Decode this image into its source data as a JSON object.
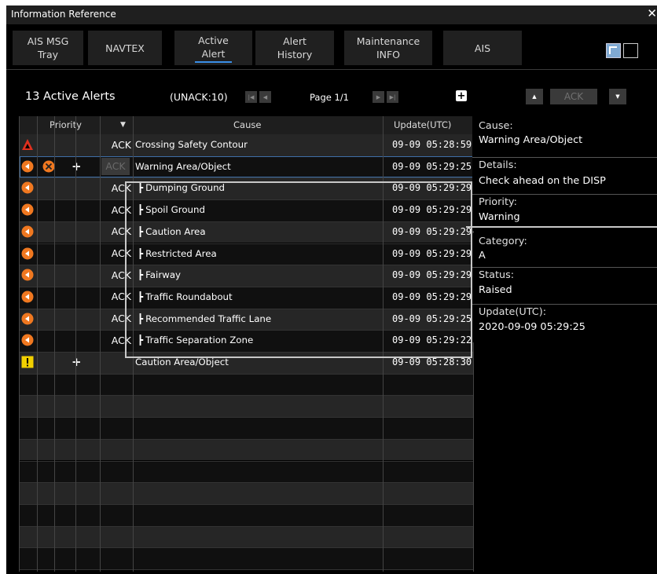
{
  "window": {
    "title": "Information Reference"
  },
  "tabs": [
    {
      "label": "AIS MSG\nTray",
      "active": false
    },
    {
      "label": "NAVTEX",
      "active": false
    },
    {
      "label": "Active\nAlert",
      "active": true
    },
    {
      "label": "Alert\nHistory",
      "active": false
    },
    {
      "label": "Maintenance\nINFO",
      "active": false
    },
    {
      "label": "AIS",
      "active": false
    }
  ],
  "toolbar": {
    "count_label": "13 Active Alerts",
    "unack_label": "(UNACK:10)",
    "page_label": "Page 1/1",
    "ack_label": "ACK"
  },
  "table": {
    "headers": {
      "priority": "Priority",
      "cause": "Cause",
      "update": "Update(UTC)"
    },
    "rows": [
      {
        "icon": "alarm-triangle-icon",
        "icon2": "",
        "plus": "",
        "ack": "ACK",
        "ack_dim": false,
        "child": false,
        "cause": "Crossing Safety Contour",
        "time": "09-09 05:28:59"
      },
      {
        "icon": "warning-circle-icon",
        "icon2": "cancelled-warning-icon",
        "plus": "+",
        "ack": "ACK",
        "ack_dim": true,
        "child": false,
        "cause": "Warning Area/Object",
        "time": "09-09 05:29:25",
        "selected": true
      },
      {
        "icon": "warning-circle-icon",
        "icon2": "",
        "plus": "",
        "ack": "ACK",
        "ack_dim": false,
        "child": true,
        "cause": "Dumping Ground",
        "time": "09-09 05:29:29"
      },
      {
        "icon": "warning-circle-icon",
        "icon2": "",
        "plus": "",
        "ack": "ACK",
        "ack_dim": false,
        "child": true,
        "cause": "Spoil Ground",
        "time": "09-09 05:29:29"
      },
      {
        "icon": "warning-circle-icon",
        "icon2": "",
        "plus": "",
        "ack": "ACK",
        "ack_dim": false,
        "child": true,
        "cause": "Caution Area",
        "time": "09-09 05:29:29"
      },
      {
        "icon": "warning-circle-icon",
        "icon2": "",
        "plus": "",
        "ack": "ACK",
        "ack_dim": false,
        "child": true,
        "cause": "Restricted Area",
        "time": "09-09 05:29:29"
      },
      {
        "icon": "warning-circle-icon",
        "icon2": "",
        "plus": "",
        "ack": "ACK",
        "ack_dim": false,
        "child": true,
        "cause": "Fairway",
        "time": "09-09 05:29:29"
      },
      {
        "icon": "warning-circle-icon",
        "icon2": "",
        "plus": "",
        "ack": "ACK",
        "ack_dim": false,
        "child": true,
        "cause": "Traffic Roundabout",
        "time": "09-09 05:29:29"
      },
      {
        "icon": "warning-circle-icon",
        "icon2": "",
        "plus": "",
        "ack": "ACK",
        "ack_dim": false,
        "child": true,
        "cause": "Recommended Traffic Lane",
        "time": "09-09 05:29:25"
      },
      {
        "icon": "warning-circle-icon",
        "icon2": "",
        "plus": "",
        "ack": "ACK",
        "ack_dim": false,
        "child": true,
        "cause": "Traffic Separation Zone",
        "time": "09-09 05:29:22"
      },
      {
        "icon": "caution-square-icon",
        "icon2": "",
        "plus": "+",
        "ack": "",
        "ack_dim": false,
        "child": false,
        "cause": "Caution Area/Object",
        "time": "09-09 05:28:30"
      }
    ],
    "empty_rows": 9
  },
  "details": {
    "cause_key": "Cause:",
    "cause_val": "Warning Area/Object",
    "details_key": "Details:",
    "details_val": "Check ahead on the DISP",
    "priority_key": "Priority:",
    "priority_val": "Warning",
    "category_key": "Category:",
    "category_val": "A",
    "status_key": "Status:",
    "status_val": "Raised",
    "update_key": "Update(UTC):",
    "update_val": "2020-09-09 05:29:25"
  },
  "colors": {
    "alarm": "#e0301e",
    "warning": "#f07820",
    "caution": "#f2d000",
    "selection": "#3e6fa8"
  }
}
